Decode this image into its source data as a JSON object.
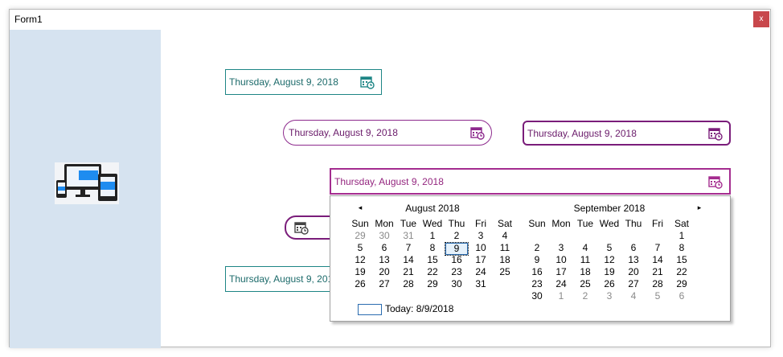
{
  "window": {
    "title": "Form1",
    "close_label": "x"
  },
  "pickers": [
    {
      "value": "Thursday, August 9, 2018"
    },
    {
      "value": "Thursday, August 9, 2018"
    },
    {
      "value": "Thursday, August 9, 2018"
    },
    {
      "value": "Thursday, August 9, 2018"
    },
    {
      "value": ""
    },
    {
      "value": "Thursday, August 9, 2018"
    }
  ],
  "calendar": {
    "prev_glyph": "◂",
    "next_glyph": "▸",
    "days_of_week": [
      "Sun",
      "Mon",
      "Tue",
      "Wed",
      "Thu",
      "Fri",
      "Sat"
    ],
    "months": [
      {
        "title": "August 2018",
        "weeks": [
          [
            "29",
            "30",
            "31",
            "1",
            "2",
            "3",
            "4"
          ],
          [
            "5",
            "6",
            "7",
            "8",
            "9",
            "10",
            "11"
          ],
          [
            "12",
            "13",
            "14",
            "15",
            "16",
            "17",
            "18"
          ],
          [
            "19",
            "20",
            "21",
            "22",
            "23",
            "24",
            "25"
          ],
          [
            "26",
            "27",
            "28",
            "29",
            "30",
            "31",
            ""
          ]
        ],
        "leading_other": 3
      },
      {
        "title": "September 2018",
        "weeks": [
          [
            "",
            "",
            "",
            "",
            "",
            "",
            "1"
          ],
          [
            "2",
            "3",
            "4",
            "5",
            "6",
            "7",
            "8"
          ],
          [
            "9",
            "10",
            "11",
            "12",
            "13",
            "14",
            "15"
          ],
          [
            "16",
            "17",
            "18",
            "19",
            "20",
            "21",
            "22"
          ],
          [
            "23",
            "24",
            "25",
            "26",
            "27",
            "28",
            "29"
          ],
          [
            "30",
            "1",
            "2",
            "3",
            "4",
            "5",
            "6"
          ]
        ],
        "trailing_other_from": 1
      }
    ],
    "selected_day": "9",
    "today_label": "Today: 8/9/2018"
  },
  "colors": {
    "sidebar": "#d6e3f0",
    "teal": "#1d8585",
    "purple": "#7a1d7a",
    "magenta": "#a42c8f"
  },
  "icons": {
    "calendar": "calendar-clock-icon",
    "logo": "devices-logo-icon"
  }
}
